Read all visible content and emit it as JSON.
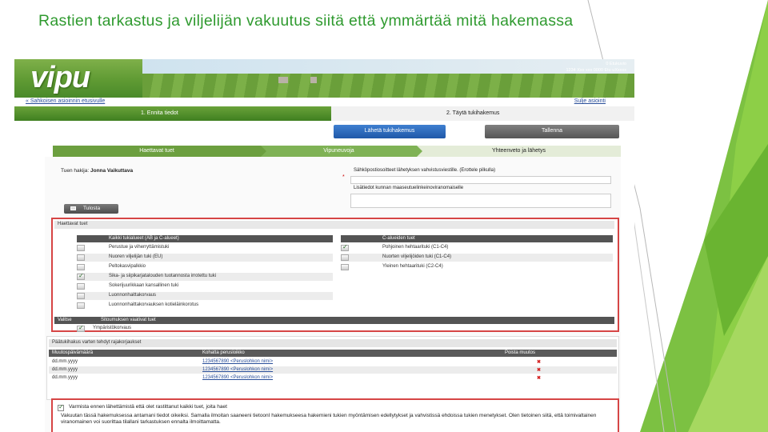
{
  "slide": {
    "title": "Rastien tarkastus ja viljelijän vakuutus siitä että ymmärtää mitä hakemassa",
    "accent_color": "#8dc63f"
  },
  "app": {
    "logo": "vipu",
    "user_info": [
      "0 Etukuvio",
      "1234 Xxx xxx 0000  Etu  uXxxxx"
    ],
    "back_link": "« Sahkoisen asioinnin etusivulle",
    "exit_link": "Sulje asiointi"
  },
  "steps": {
    "step1": "1. Ennita tiedot",
    "step2": "2. Täytä tukihakemus"
  },
  "buttons": {
    "send": "Lähetä tukihakemus",
    "save": "Tallenna",
    "print": "Tulosta"
  },
  "tabs": [
    "Haettavat tuet",
    "Vipuneuvoja",
    "Yhteenveto ja lähetys"
  ],
  "applicant": {
    "label": "Tuen hakija:",
    "name": "Jonna Vaikuttava"
  },
  "form": {
    "email_label": "Sähköpostiosoitteet lähetyksen vahvistusviestille. (Erottele pilkulla)",
    "info_label": "Lisätiedot kunnan maaseutuelinkeinoviranomaiselle"
  },
  "support_section": {
    "title": "Haettavat tuet",
    "left_header": "Kaikki tukialueet (AB ja C-alueet)",
    "right_header": "C-alueiden tuet",
    "left_items": [
      {
        "label": "Perustue ja viherryttämistuki",
        "checked": false
      },
      {
        "label": "Nuoren viljelijän tuki (EU)",
        "checked": false
      },
      {
        "label": "Peltokasvipalkkio",
        "checked": false
      },
      {
        "label": "Sika- ja siipikarjatalouden tuotannosta irrotettu tuki",
        "checked": true
      },
      {
        "label": "Sokerijuurikkaan kansallinen tuki",
        "checked": false
      },
      {
        "label": "Luonnonhaittakorvaus",
        "checked": false
      },
      {
        "label": "Luonnonhaittakorvauksen kotieläinkorotus",
        "checked": false
      }
    ],
    "right_items": [
      {
        "label": "Pohjoinen hehtaarituki (C1-C4)",
        "checked": true
      },
      {
        "label": "Nuorten viljelijöiden tuki (C1-C4)",
        "checked": false
      },
      {
        "label": "Yleinen hehtaarituki (C2-C4)",
        "checked": false
      }
    ],
    "env_col_select": "Valitse",
    "env_col_title": "Sitoumuksen vaativat tuet",
    "env_item": {
      "label": "Ympäristökorvaus",
      "checked": true
    }
  },
  "documents": {
    "title": "Päätukihakus varten tehdyt rajakorjaukset",
    "columns": [
      "Muutospäivämäärä",
      "Kohatta perusloikko",
      "Poista muutos"
    ],
    "rows": [
      {
        "date": "dd.mm.yyyy",
        "link": "1234567890 <Peruslohkon nimi>"
      },
      {
        "date": "dd.mm.yyyy",
        "link": "1234567890 <Peruslohkon nimi>"
      },
      {
        "date": "dd.mm.yyyy",
        "link": "1234567890 <Peruslohkon nimi>"
      }
    ],
    "delete_icon": "✖"
  },
  "confirm": {
    "title": "Varmista ennen lähettämistä että olet rastittanut kaikki tuet, joita haet",
    "text": "Vakuutan tässä hakemuksessa antamani tiedot oikeiksi. Samalla ilmoitan saaneeni tietoonI hakemukseesa hakemieni tukien myöntämisen edellytykset ja vahvistissä ehdoissa tukien menetykset. Olen tietoinen siitä, että toimivaltainen viranomainen voi suorittaa tilallani tarkastuksen ennalta ilmoittamatta."
  }
}
